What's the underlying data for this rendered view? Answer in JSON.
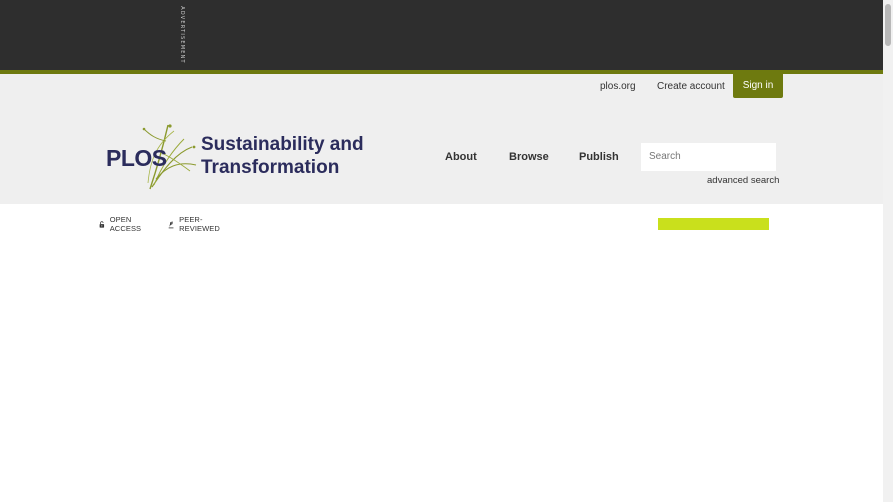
{
  "ad": {
    "label": "ADVERTISEMENT"
  },
  "top_links": {
    "plos_org": "plos.org",
    "create_account": "Create account",
    "sign_in": "Sign in"
  },
  "logo": {
    "plos": "PLOS",
    "title_line1": "Sustainability and",
    "title_line2": "Transformation"
  },
  "nav": {
    "about": "About",
    "browse": "Browse",
    "publish": "Publish"
  },
  "search": {
    "placeholder": "Search",
    "advanced": "advanced search"
  },
  "badges": {
    "open_access": "OPEN ACCESS",
    "peer_reviewed": "PEER-REVIEWED"
  },
  "colors": {
    "accent": "#6e7a0f",
    "brand_text": "#2b2c5c",
    "highlight": "#c9e01c"
  },
  "icons": {
    "open_access": "unlocked-padlock-icon",
    "peer_reviewed": "peer-review-icon"
  }
}
